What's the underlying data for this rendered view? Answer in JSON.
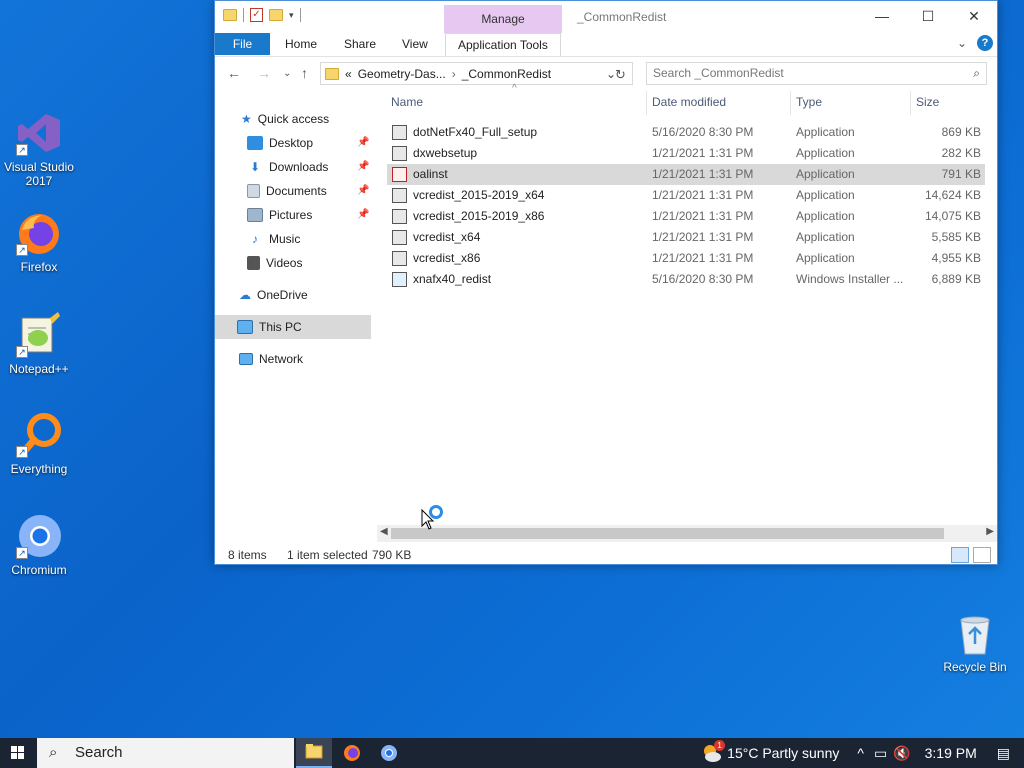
{
  "desktop": {
    "icons": [
      {
        "label": "Visual Studio 2017"
      },
      {
        "label": "Firefox"
      },
      {
        "label": "Notepad++"
      },
      {
        "label": "Everything"
      },
      {
        "label": "Chromium"
      }
    ],
    "recycle_bin": "Recycle Bin"
  },
  "window": {
    "title": "_CommonRedist",
    "manage_tab": "Manage",
    "tabs": {
      "file": "File",
      "home": "Home",
      "share": "Share",
      "view": "View",
      "app_tools": "Application Tools"
    },
    "help": "?",
    "address": {
      "prefix": "«",
      "crumb1": "Geometry-Das...",
      "crumb2": "_CommonRedist"
    },
    "search_placeholder": "Search _CommonRedist",
    "nav": {
      "quick_access": "Quick access",
      "desktop": "Desktop",
      "downloads": "Downloads",
      "documents": "Documents",
      "pictures": "Pictures",
      "music": "Music",
      "videos": "Videos",
      "onedrive": "OneDrive",
      "this_pc": "This PC",
      "network": "Network"
    },
    "columns": {
      "name": "Name",
      "date": "Date modified",
      "type": "Type",
      "size": "Size"
    },
    "files": [
      {
        "name": "dotNetFx40_Full_setup",
        "date": "5/16/2020 8:30 PM",
        "type": "Application",
        "size": "869 KB"
      },
      {
        "name": "dxwebsetup",
        "date": "1/21/2021 1:31 PM",
        "type": "Application",
        "size": "282 KB"
      },
      {
        "name": "oalinst",
        "date": "1/21/2021 1:31 PM",
        "type": "Application",
        "size": "791 KB"
      },
      {
        "name": "vcredist_2015-2019_x64",
        "date": "1/21/2021 1:31 PM",
        "type": "Application",
        "size": "14,624 KB"
      },
      {
        "name": "vcredist_2015-2019_x86",
        "date": "1/21/2021 1:31 PM",
        "type": "Application",
        "size": "14,075 KB"
      },
      {
        "name": "vcredist_x64",
        "date": "1/21/2021 1:31 PM",
        "type": "Application",
        "size": "5,585 KB"
      },
      {
        "name": "vcredist_x86",
        "date": "1/21/2021 1:31 PM",
        "type": "Application",
        "size": "4,955 KB"
      },
      {
        "name": "xnafx40_redist",
        "date": "5/16/2020 8:30 PM",
        "type": "Windows Installer ...",
        "size": "6,889 KB"
      }
    ],
    "status": {
      "count": "8 items",
      "selected": "1 item selected",
      "size": "790 KB"
    }
  },
  "taskbar": {
    "search": "Search",
    "weather_badge": "1",
    "weather": "15°C  Partly sunny",
    "clock": "3:19 PM"
  },
  "colors": {
    "accent": "#1979ca",
    "desktop": "#0a63c9",
    "taskbar": "#1b2433",
    "manage": "#e6c8f0"
  }
}
